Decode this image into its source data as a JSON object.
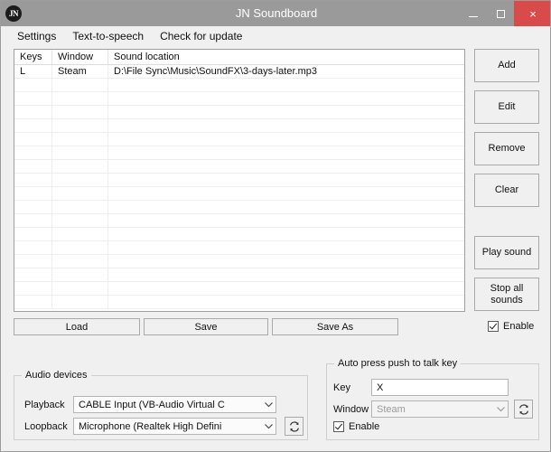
{
  "window": {
    "title": "JN Soundboard",
    "icon_label": "JN",
    "controls": {
      "minimize": "minimize-icon",
      "maximize": "maximize-icon",
      "close": "×"
    }
  },
  "menubar": {
    "items": [
      {
        "label": "Settings"
      },
      {
        "label": "Text-to-speech"
      },
      {
        "label": "Check for update"
      }
    ]
  },
  "sound_list": {
    "columns": [
      "Keys",
      "Window",
      "Sound location"
    ],
    "rows": [
      {
        "keys": "L",
        "window": "Steam",
        "sound_location": "D:\\File Sync\\Music\\SoundFX\\3-days-later.mp3"
      }
    ],
    "empty_row_count": 17
  },
  "side_buttons": {
    "add": "Add",
    "edit": "Edit",
    "remove": "Remove",
    "clear": "Clear",
    "play_sound": "Play sound",
    "stop_all_sounds": "Stop all\nsounds",
    "stop_all_sounds_line1": "Stop all",
    "stop_all_sounds_line2": "sounds"
  },
  "bottom_buttons": {
    "load": "Load",
    "save": "Save",
    "save_as": "Save As"
  },
  "list_enable": {
    "label": "Enable",
    "checked": true
  },
  "audio_devices": {
    "title": "Audio devices",
    "playback": {
      "label": "Playback",
      "value": "CABLE Input (VB-Audio Virtual C"
    },
    "loopback": {
      "label": "Loopback",
      "value": "Microphone (Realtek High Defini"
    },
    "refresh_icon": "refresh-icon"
  },
  "push_to_talk": {
    "title": "Auto press push to talk key",
    "key": {
      "label": "Key",
      "value": "X"
    },
    "window": {
      "label": "Window",
      "value": "Steam",
      "disabled": true
    },
    "enable": {
      "label": "Enable",
      "checked": true
    },
    "refresh_icon": "refresh-icon"
  },
  "colors": {
    "titlebar": "#9a9a9a",
    "close_button": "#d94b4b",
    "window_background": "#f0f0f0",
    "list_background": "#ffffff",
    "button_face": "#f0f0f0"
  }
}
